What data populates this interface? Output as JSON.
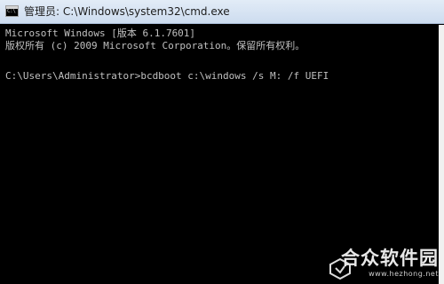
{
  "window": {
    "title": "管理员: C:\\Windows\\system32\\cmd.exe",
    "icon": "cmd-icon"
  },
  "console": {
    "lines": [
      "Microsoft Windows [版本 6.1.7601]",
      "版权所有 (c) 2009 Microsoft Corporation。保留所有权利。",
      "",
      "C:\\Users\\Administrator>bcdboot c:\\windows /s M: /f UEFI"
    ]
  },
  "watermark": {
    "name": "合众软件园",
    "url": "www.hezhong.net"
  },
  "colors": {
    "console_bg": "#000000",
    "console_text": "#c0c0c0",
    "titlebar": "#dbe6f4"
  }
}
